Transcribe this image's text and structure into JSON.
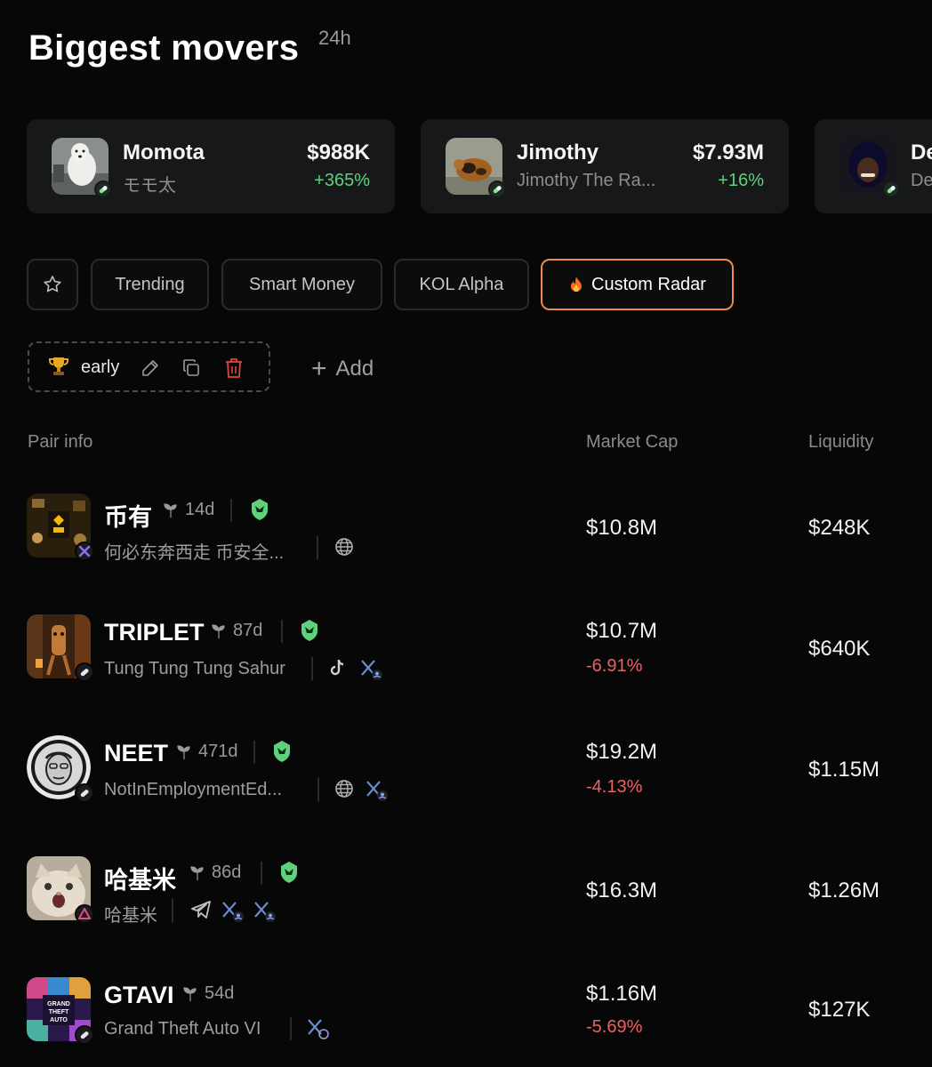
{
  "header": {
    "title": "Biggest movers",
    "period": "24h"
  },
  "movers": [
    {
      "name": "Momota",
      "subtitle": "モモ太",
      "price": "$988K",
      "change": "+365%"
    },
    {
      "name": "Jimothy",
      "subtitle": "Jimothy The Ra...",
      "price": "$7.93M",
      "change": "+16%"
    },
    {
      "name": "De",
      "subtitle": "De",
      "price": "",
      "change": ""
    }
  ],
  "tabs": [
    {
      "label": "Trending"
    },
    {
      "label": "Smart Money"
    },
    {
      "label": "KOL Alpha"
    },
    {
      "label": "Custom Radar",
      "active": true
    }
  ],
  "radar": {
    "label": "early",
    "add_label": "Add"
  },
  "table": {
    "columns": {
      "pair": "Pair info",
      "mcap": "Market Cap",
      "liquidity": "Liquidity"
    },
    "rows": [
      {
        "symbol": "币有",
        "age": "14d",
        "description": "何必东奔西走 币安全...",
        "mcap": "$10.8M",
        "mcap_change": "",
        "liquidity": "$248K"
      },
      {
        "symbol": "TRIPLET",
        "age": "87d",
        "description": "Tung Tung Tung Sahur",
        "mcap": "$10.7M",
        "mcap_change": "-6.91%",
        "liquidity": "$640K"
      },
      {
        "symbol": "NEET",
        "age": "471d",
        "description": "NotInEmploymentEd...",
        "mcap": "$19.2M",
        "mcap_change": "-4.13%",
        "liquidity": "$1.15M"
      },
      {
        "symbol": "哈基米",
        "age": "86d",
        "description": "哈基米",
        "mcap": "$16.3M",
        "mcap_change": "",
        "liquidity": "$1.26M"
      },
      {
        "symbol": "GTAVI",
        "age": "54d",
        "description": "Grand Theft Auto VI",
        "mcap": "$1.16M",
        "mcap_change": "-5.69%",
        "liquidity": "$127K"
      }
    ]
  },
  "colors": {
    "accent": "#ef8a49",
    "positive": "#5fd07b",
    "negative": "#e86363",
    "background": "#070707",
    "card": "#17181a"
  }
}
